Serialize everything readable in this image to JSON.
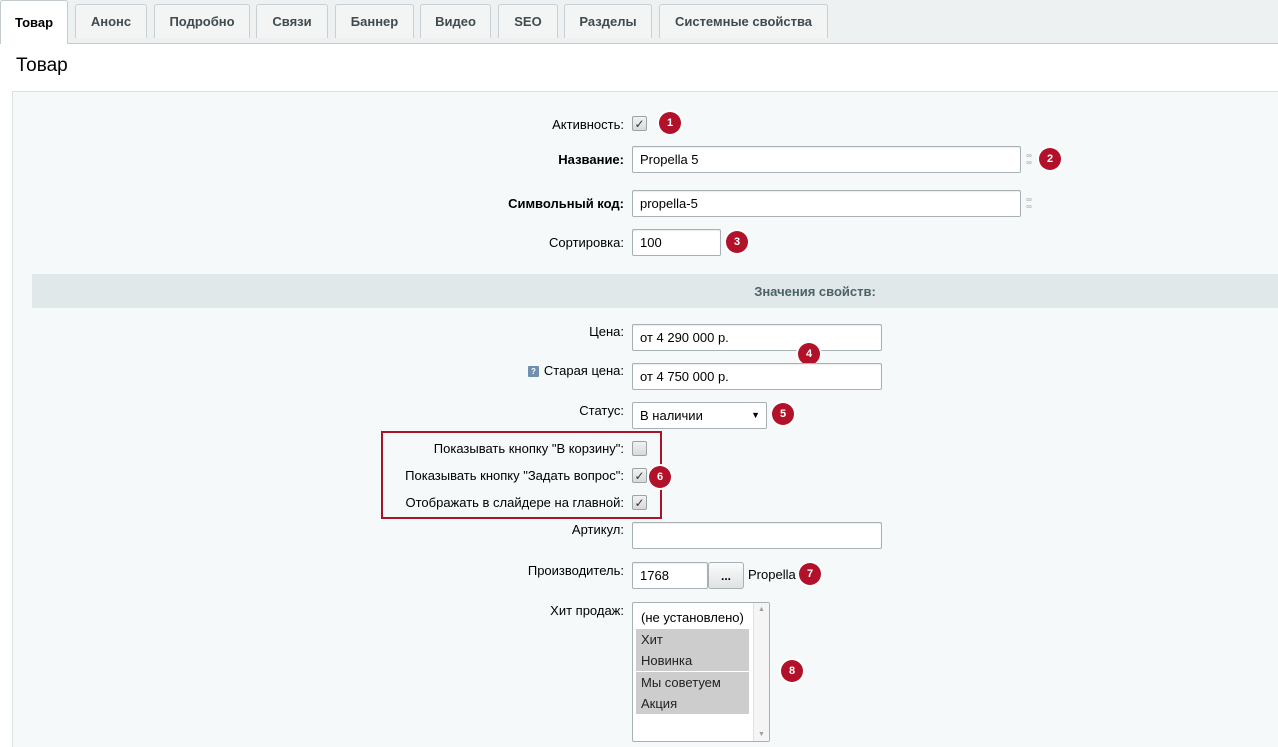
{
  "tabs": [
    {
      "label": "Товар",
      "active": true
    },
    {
      "label": "Анонс"
    },
    {
      "label": "Подробно"
    },
    {
      "label": "Связи"
    },
    {
      "label": "Баннер"
    },
    {
      "label": "Видео"
    },
    {
      "label": "SEO"
    },
    {
      "label": "Разделы"
    },
    {
      "label": "Системные свойства"
    }
  ],
  "page_title": "Товар",
  "fields": {
    "activity": {
      "label": "Активность:",
      "checked": true
    },
    "name": {
      "label": "Название:",
      "value": "Propella 5"
    },
    "code": {
      "label": "Символьный код:",
      "value": "propella-5"
    },
    "sort": {
      "label": "Сортировка:",
      "value": "100"
    }
  },
  "section_title": "Значения свойств:",
  "props": {
    "price": {
      "label": "Цена:",
      "value": "от 4 290 000 р."
    },
    "old_price": {
      "label": "Старая цена:",
      "value": "от 4 750 000 р.",
      "help_icon": "?"
    },
    "status": {
      "label": "Статус:",
      "value": "В наличии"
    },
    "show_cart": {
      "label": "Показывать кнопку \"В корзину\":",
      "checked": false
    },
    "show_ask": {
      "label": "Показывать кнопку \"Задать вопрос\":",
      "checked": true
    },
    "show_slider": {
      "label": "Отображать в слайдере на главной:",
      "checked": true
    },
    "article": {
      "label": "Артикул:",
      "value": ""
    },
    "manufacturer": {
      "label": "Производитель:",
      "value": "1768",
      "button": "...",
      "name": "Propella"
    },
    "hit": {
      "label": "Хит продаж:",
      "options": [
        {
          "label": "(не установлено)",
          "selected": false
        },
        {
          "label": "Хит",
          "selected": true
        },
        {
          "label": "Новинка",
          "selected": true
        },
        {
          "label": "Мы советуем",
          "selected": true
        },
        {
          "label": "Акция",
          "selected": true
        }
      ]
    }
  },
  "badges": [
    "1",
    "2",
    "3",
    "4",
    "5",
    "6",
    "7",
    "8"
  ],
  "icons": {
    "check": "✓",
    "dropdown": "▼",
    "scroll_up": "▲",
    "scroll_down": "▼",
    "translit": "link-icon"
  },
  "colors": {
    "badge": "#b2112a",
    "highlight_border": "#a5162b",
    "section_bg": "#e0e8ea"
  }
}
